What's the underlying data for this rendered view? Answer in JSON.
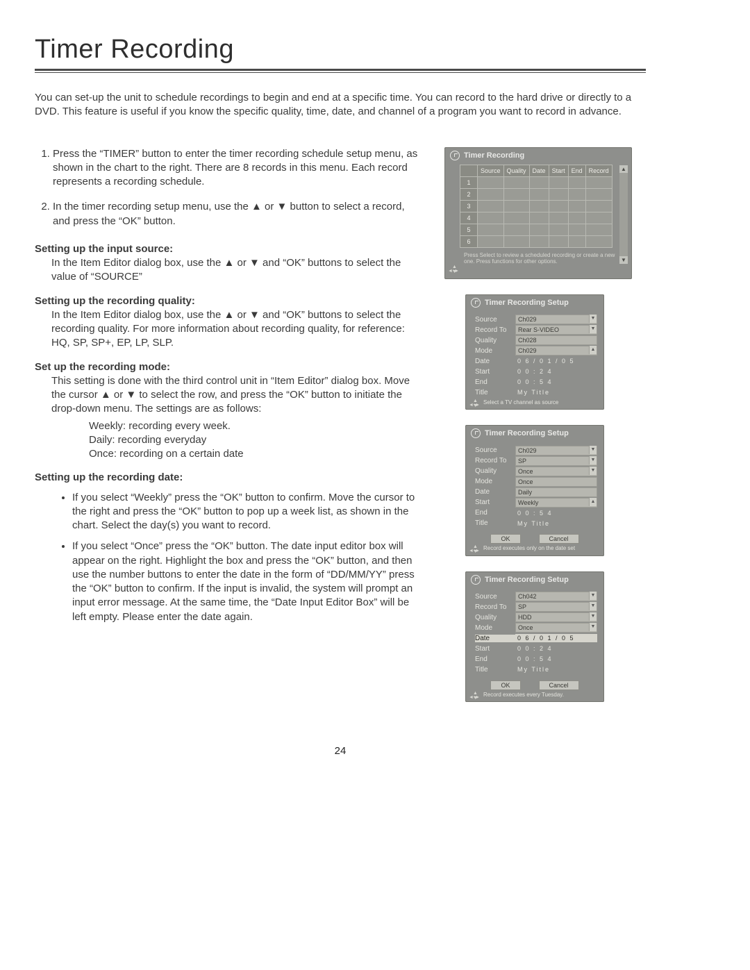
{
  "title": "Timer Recording",
  "intro": "You can set-up the unit to schedule recordings to begin and end at a specific time.  You can record to the hard drive or directly to a DVD. This feature is useful if you know the specific quality, time, date, and channel of a program you want to record in advance.",
  "steps": {
    "s1": "Press the “TIMER” button to enter the timer recording schedule setup menu, as shown in the chart to the right. There are 8 records in this menu. Each record represents a recording schedule.",
    "s2": "In the timer recording setup menu, use the ▲ or ▼ button to select a record, and press the “OK” button."
  },
  "sections": {
    "src_h": "Setting up the input source:",
    "src_b": "In the Item Editor dialog box, use the ▲ or ▼ and “OK” buttons to select the value of “SOURCE”",
    "qual_h": "Setting up the recording quality:",
    "qual_b": "In the Item Editor dialog box, use the ▲ or ▼ and “OK” buttons to select the recording quality. For more information about recording quality, for reference: HQ, SP, SP+, EP, LP, SLP.",
    "mode_h": "Set up the recording mode:",
    "mode_b": "This setting is done with the third control unit in “Item Editor” dialog box. Move the cursor ▲ or ▼ to select the row, and press the “OK” button to initiate the drop-down menu.  The settings are as follows:",
    "mode_w": "Weekly: recording every week.",
    "mode_d": "Daily: recording everyday",
    "mode_o": "Once: recording on a certain date",
    "date_h": "Setting up the recording date:",
    "date_b1": "If you select “Weekly” press the “OK” button to confirm. Move the cursor to the right and press the “OK” button to pop up a week list, as shown in the chart. Select the day(s) you want to record.",
    "date_b2": "If you select “Once” press the “OK” button. The date input editor box will appear on the right. Highlight the box and press the “OK” button, and then use the number buttons to enter the date in the form of “DD/MM/YY” press the “OK” button to confirm. If the input is invalid, the system will prompt an input error message. At the same time, the “Date Input Editor Box” will be left empty. Please enter the date again."
  },
  "panel_table": {
    "title": "Timer Recording",
    "cols": [
      "Source",
      "Quality",
      "Date",
      "Start",
      "End",
      "Record"
    ],
    "rows": [
      "1",
      "2",
      "3",
      "4",
      "5",
      "6"
    ],
    "hint": "Press Select to review a scheduled recording or create a new one. Press functions for other options."
  },
  "panel_setup_title": "Timer Recording Setup",
  "labels": {
    "source": "Source",
    "recto": "Record To",
    "quality": "Quality",
    "mode": "Mode",
    "date": "Date",
    "start": "Start",
    "end": "End",
    "titlel": "Title"
  },
  "setup1": {
    "source": "Ch029",
    "recto": "Rear S-VIDEO",
    "quality": "Ch028",
    "mode": "Ch029",
    "date": "0 6 / 0  1 / 0  5",
    "start": "0 0  : 2  4",
    "end": "0 0  : 5  4",
    "title": "My  Title",
    "foot": "Select a TV channel as source"
  },
  "setup2": {
    "source": "Ch029",
    "recto": "SP",
    "quality": "Once",
    "mode": "Once",
    "date": "Daily",
    "start": "Weekly",
    "end": "0 0  : 5  4",
    "title": "My  Title",
    "foot": "Record  executes only on the date set"
  },
  "setup3": {
    "source": "Ch042",
    "recto": "SP",
    "quality": "HDD",
    "mode": "Once",
    "date": "0 6 / 0  1 / 0  5",
    "start": "0 0  : 2  4",
    "end": "0 0  : 5  4",
    "title": "My  Title",
    "foot": "Record executes every Tuesday."
  },
  "buttons": {
    "ok": "OK",
    "cancel": "Cancel"
  },
  "page_number": "24"
}
